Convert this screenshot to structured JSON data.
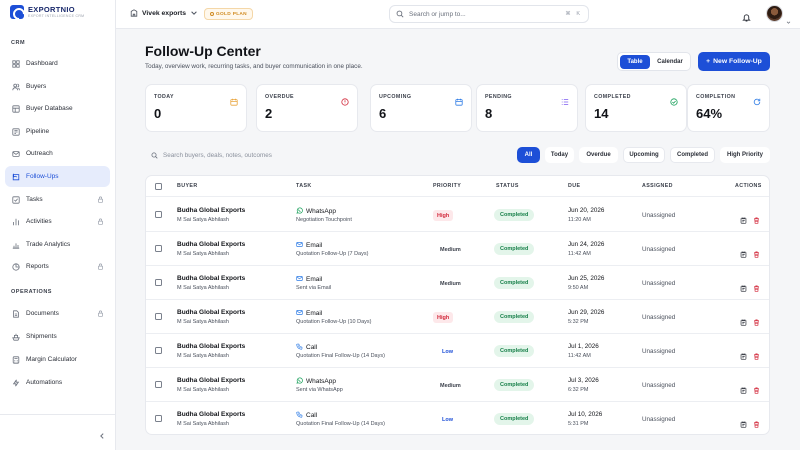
{
  "brand": {
    "name": "EXPORTNIO",
    "tagline": "EXPORT INTELLIGENCE CRM"
  },
  "sidebar": {
    "crm_label": "CRM",
    "operations_label": "OPERATIONS",
    "crm_items": [
      {
        "label": "Dashboard",
        "icon": "grid-icon",
        "locked": false
      },
      {
        "label": "Buyers",
        "icon": "users-icon",
        "locked": false
      },
      {
        "label": "Buyer Database",
        "icon": "database-icon",
        "locked": false
      },
      {
        "label": "Pipeline",
        "icon": "pipeline-icon",
        "locked": false
      },
      {
        "label": "Outreach",
        "icon": "mail-icon",
        "locked": false
      },
      {
        "label": "Follow-Ups",
        "icon": "calendar-check-icon",
        "locked": false,
        "active": true
      },
      {
        "label": "Tasks",
        "icon": "checklist-icon",
        "locked": true
      },
      {
        "label": "Activities",
        "icon": "activity-icon",
        "locked": true
      },
      {
        "label": "Trade Analytics",
        "icon": "bar-chart-icon",
        "locked": false
      },
      {
        "label": "Reports",
        "icon": "report-icon",
        "locked": true
      }
    ],
    "operations_items": [
      {
        "label": "Documents",
        "icon": "document-icon",
        "locked": true
      },
      {
        "label": "Shipments",
        "icon": "shipment-icon",
        "locked": false
      },
      {
        "label": "Margin Calculator",
        "icon": "calculator-icon",
        "locked": false
      },
      {
        "label": "Automations",
        "icon": "lightning-icon",
        "locked": false
      }
    ]
  },
  "topbar": {
    "workspace": "Vivek exports",
    "plan": "GOLD PLAN",
    "search_placeholder": "Search or jump to...",
    "shortcut": "⌘ K"
  },
  "header": {
    "title": "Follow-Up Center",
    "subtitle": "Today, overview work, recurring tasks, and buyer communication in one place.",
    "view_table": "Table",
    "view_calendar": "Calendar",
    "new_button": "New Follow-Up"
  },
  "stats": [
    {
      "label": "TODAY",
      "value": "0",
      "color": "#e8a33a"
    },
    {
      "label": "OVERDUE",
      "value": "2",
      "color": "#d2283a"
    },
    {
      "label": "UPCOMING",
      "value": "6",
      "color": "#2d7be5"
    },
    {
      "label": "PENDING",
      "value": "8",
      "color": "#7c5cf0"
    },
    {
      "label": "COMPLETED",
      "value": "14",
      "color": "#18a05a"
    },
    {
      "label": "COMPLETION",
      "value": "64%",
      "color": "#2d7be5"
    }
  ],
  "filters": {
    "search_placeholder": "Search buyers, deals, notes, outcomes",
    "chips": [
      "All",
      "Today",
      "Overdue",
      "Upcoming",
      "Completed",
      "High Priority"
    ]
  },
  "table": {
    "headers": [
      "BUYER",
      "TASK",
      "PRIORITY",
      "STATUS",
      "DUE",
      "ASSIGNED",
      "ACTIONS"
    ],
    "rows": [
      {
        "buyer": "Budha Global Exports",
        "contact": "M Sai Satya Abhilash",
        "task_type": "WhatsApp",
        "task_icon": "whatsapp-icon",
        "task_sub": "Negotiation Touchpoint",
        "priority": "High",
        "status": "Completed",
        "due_date": "Jun 20, 2026",
        "due_time": "11:20 AM",
        "assigned": "Unassigned"
      },
      {
        "buyer": "Budha Global Exports",
        "contact": "M Sai Satya Abhilash",
        "task_type": "Email",
        "task_icon": "email-icon",
        "task_sub": "Quotation Follow-Up (7 Days)",
        "priority": "Medium",
        "status": "Completed",
        "due_date": "Jun 24, 2026",
        "due_time": "11:42 AM",
        "assigned": "Unassigned"
      },
      {
        "buyer": "Budha Global Exports",
        "contact": "M Sai Satya Abhilash",
        "task_type": "Email",
        "task_icon": "email-icon",
        "task_sub": "Sent via Email",
        "priority": "Medium",
        "status": "Completed",
        "due_date": "Jun 25, 2026",
        "due_time": "9:50 AM",
        "assigned": "Unassigned"
      },
      {
        "buyer": "Budha Global Exports",
        "contact": "M Sai Satya Abhilash",
        "task_type": "Email",
        "task_icon": "email-icon",
        "task_sub": "Quotation Follow-Up (10 Days)",
        "priority": "High",
        "status": "Completed",
        "due_date": "Jun 29, 2026",
        "due_time": "5:32 PM",
        "assigned": "Unassigned"
      },
      {
        "buyer": "Budha Global Exports",
        "contact": "M Sai Satya Abhilash",
        "task_type": "Call",
        "task_icon": "phone-icon",
        "task_sub": "Quotation Final Follow-Up (14 Days)",
        "priority": "Low",
        "status": "Completed",
        "due_date": "Jul 1, 2026",
        "due_time": "11:42 AM",
        "assigned": "Unassigned"
      },
      {
        "buyer": "Budha Global Exports",
        "contact": "M Sai Satya Abhilash",
        "task_type": "WhatsApp",
        "task_icon": "whatsapp-icon",
        "task_sub": "Sent via WhatsApp",
        "priority": "Medium",
        "status": "Completed",
        "due_date": "Jul 3, 2026",
        "due_time": "6:32 PM",
        "assigned": "Unassigned"
      },
      {
        "buyer": "Budha Global Exports",
        "contact": "M Sai Satya Abhilash",
        "task_type": "Call",
        "task_icon": "phone-icon",
        "task_sub": "Quotation Final Follow-Up (14 Days)",
        "priority": "Low",
        "status": "Completed",
        "due_date": "Jul 10, 2026",
        "due_time": "5:31 PM",
        "assigned": "Unassigned"
      }
    ]
  }
}
